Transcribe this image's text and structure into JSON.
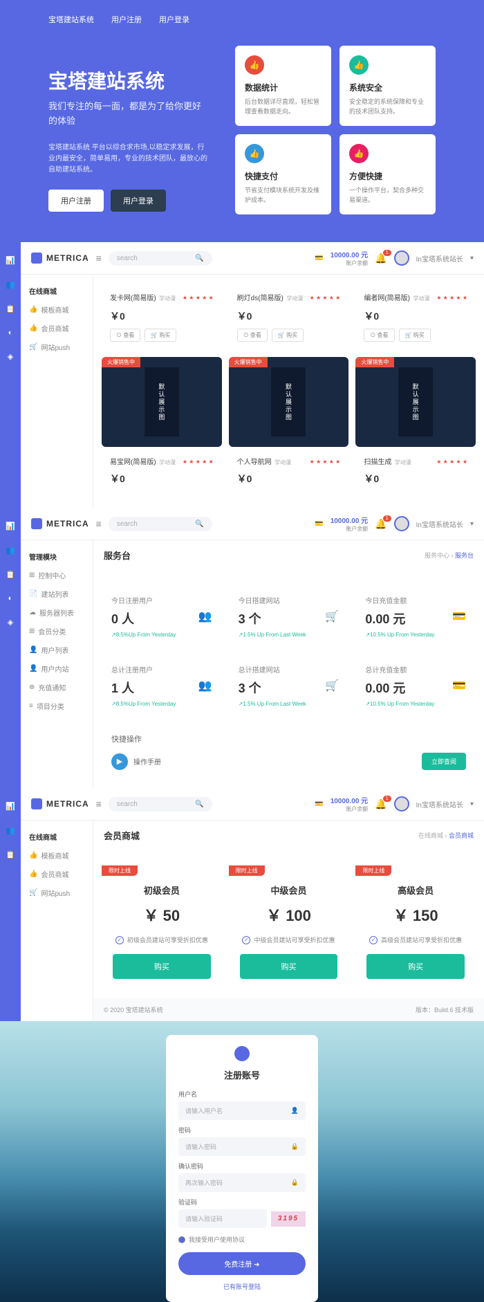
{
  "hero": {
    "nav": [
      "宝塔建站系统",
      "用户注册",
      "用户登录"
    ],
    "title": "宝塔建站系统",
    "subtitle": "我们专注的每一面，都是为了给你更好的体验",
    "desc": "宝塔建站系统 平台以综合求市场,以稳定求发展，行业内最安全，简单易用，专业的技术团队，最放心的自助建站系统。",
    "btn_reg": "用户注册",
    "btn_login": "用户登录",
    "cards": [
      {
        "icon": "👍",
        "title": "数据统计",
        "desc": "后台数据详尽直观，轻松管理查看数据走向。"
      },
      {
        "icon": "👍",
        "title": "系统安全",
        "desc": "安全稳定的系统保障和专业的技术团队支持。"
      },
      {
        "icon": "👍",
        "title": "快捷支付",
        "desc": "节省支付模块系统开发及维护成本。"
      },
      {
        "icon": "👍",
        "title": "方便快捷",
        "desc": "一个操作平台，契合多种交易渠道。"
      }
    ]
  },
  "common": {
    "brand": "METRICA",
    "search_ph": "search",
    "balance": "10000.00 元",
    "balance_label": "账户余额",
    "username": "In宝塔系统站长",
    "notif_count": "1"
  },
  "panel1": {
    "menu_hdr": "在线商城",
    "menu": [
      "模板商城",
      "会员商城",
      "网站push"
    ],
    "products_top": [
      {
        "name": "发卡网(简易版)",
        "sub": "学动漫",
        "price": "￥0"
      },
      {
        "name": "刷灯ds(简易版)",
        "sub": "学动漫",
        "price": "￥0"
      },
      {
        "name": "编者网(简易版)",
        "sub": "学动漫",
        "price": "￥0"
      }
    ],
    "btn_view": "⊙ 查看",
    "btn_buy": "🛒 购买",
    "hot_tag": "火爆销售中",
    "img_text": "默认展示图",
    "products_bot": [
      {
        "name": "易宝网(简易版)",
        "sub": "学动漫",
        "price": "￥0"
      },
      {
        "name": "个人导航网",
        "sub": "学动漫",
        "price": "￥0"
      },
      {
        "name": "扫描生成",
        "sub": "学动漫",
        "price": "￥0"
      }
    ]
  },
  "panel2": {
    "menu_hdr": "管理模块",
    "menu": [
      "控制中心",
      "建站列表",
      "服务器列表",
      "会员分类",
      "用户列表",
      "用户内站",
      "充值通知",
      "项目分类"
    ],
    "title": "服务台",
    "bc1": "服务中心",
    "bc2": "服务台",
    "stats": [
      {
        "label": "今日注册用户",
        "val": "0 人",
        "trend": "↗8.5%Up From Yesterday",
        "icon": "👥",
        "color": "ic-pink2"
      },
      {
        "label": "今日搭建网站",
        "val": "3 个",
        "trend": "↗1.5% Up From Last Week",
        "icon": "🛒",
        "color": "ic-teal2"
      },
      {
        "label": "今日充值金额",
        "val": "0.00 元",
        "trend": "↗10.5% Up From Yesterday",
        "icon": "💳",
        "color": "ic-teal2"
      },
      {
        "label": "总计注册用户",
        "val": "1 人",
        "trend": "↗8.5%Up From Yesterday",
        "icon": "👥",
        "color": "ic-pink2"
      },
      {
        "label": "总计搭建网站",
        "val": "3 个",
        "trend": "↗1.5% Up From Last Week",
        "icon": "🛒",
        "color": "ic-teal2"
      },
      {
        "label": "总计充值金额",
        "val": "0.00 元",
        "trend": "↗10.5% Up From Yesterday",
        "icon": "💳",
        "color": "ic-teal2"
      }
    ],
    "quick_title": "快捷操作",
    "quick_item": "操作手册",
    "quick_btn": "立即查阅"
  },
  "panel3": {
    "menu_hdr": "在线商城",
    "menu": [
      "模板商城",
      "会员商城",
      "网站push"
    ],
    "title": "会员商城",
    "bc1": "在线商城",
    "bc2": "会员商城",
    "tag": "限时上线",
    "plans": [
      {
        "name": "初级会员",
        "price": "￥ 50",
        "feat": "初级会员建站可享受折扣优惠"
      },
      {
        "name": "中级会员",
        "price": "￥ 100",
        "feat": "中级会员建站可享受折扣优惠"
      },
      {
        "name": "高级会员",
        "price": "￥ 150",
        "feat": "高级会员建站可享受折扣优惠"
      }
    ],
    "buy_btn": "购买",
    "foot_left": "© 2020 宝塔建站系统",
    "foot_right": "版本：Build.6 技术版"
  },
  "register": {
    "title": "注册账号",
    "f_user": "用户名",
    "ph_user": "请输入用户名",
    "f_pwd": "密码",
    "ph_pwd": "请输入密码",
    "f_pwd2": "确认密码",
    "ph_pwd2": "再次输入密码",
    "f_code": "验证码",
    "ph_code": "请输入验证码",
    "captcha": "3195",
    "agree": "我接受用户使用协议",
    "btn": "免费注册 ➜",
    "link": "已有账号登陆"
  }
}
